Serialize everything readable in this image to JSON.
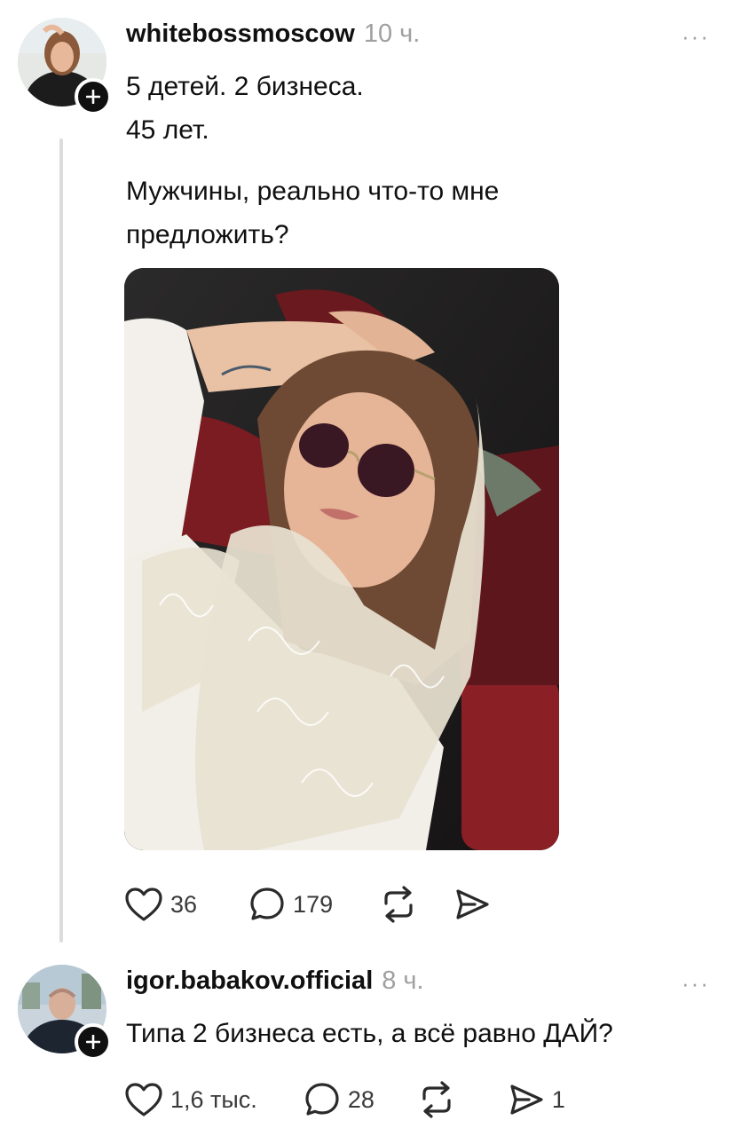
{
  "post": {
    "username": "whitebossmoscow",
    "time": "10 ч.",
    "more": "···",
    "text_line1": "5 детей. 2 бизнеса.",
    "text_line2": "45 лет.",
    "text_line3": "Мужчины, реально что-то  мне",
    "text_line4": "предложить?",
    "likes": "36",
    "replies": "179",
    "reposts": "",
    "shares": ""
  },
  "reply": {
    "username": "igor.babakov.official",
    "time": "8 ч.",
    "more": "···",
    "text": "Типа 2 бизнеса есть, а всё равно ДАЙ?",
    "likes": "1,6 тыс.",
    "replies": "28",
    "reposts": "",
    "shares": "1"
  },
  "icons": {
    "like": "heart-icon",
    "reply": "comment-bubble-icon",
    "repost": "repost-icon",
    "share": "send-icon",
    "follow": "plus-icon"
  },
  "colors": {
    "text": "#101010",
    "muted": "#a0a0a0",
    "thread_line": "#dcdcdc"
  }
}
